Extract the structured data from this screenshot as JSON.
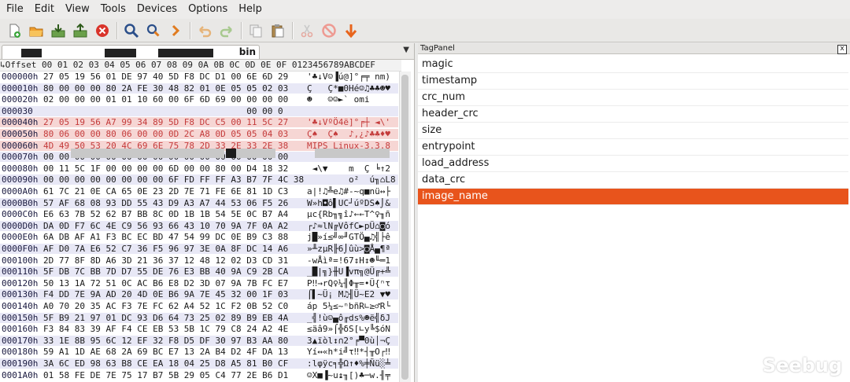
{
  "menu": [
    "File",
    "Edit",
    "View",
    "Tools",
    "Devices",
    "Options",
    "Help"
  ],
  "toolbar": {
    "buttons": [
      {
        "name": "new-file",
        "icon": "new-file-icon"
      },
      {
        "name": "open-file",
        "icon": "open-folder-icon"
      },
      {
        "name": "import",
        "icon": "import-icon"
      },
      {
        "name": "export",
        "icon": "export-icon"
      },
      {
        "name": "stop",
        "icon": "stop-icon"
      },
      {
        "name": "find",
        "icon": "magnifier-icon"
      },
      {
        "name": "find-replace",
        "icon": "find-replace-icon"
      },
      {
        "name": "go-next",
        "icon": "chevron-right-icon"
      },
      {
        "name": "undo",
        "icon": "undo-icon"
      },
      {
        "name": "redo",
        "icon": "redo-icon"
      },
      {
        "name": "copy",
        "icon": "copy-icon"
      },
      {
        "name": "paste",
        "icon": "paste-icon"
      },
      {
        "name": "cut",
        "icon": "scissors-icon"
      },
      {
        "name": "delete",
        "icon": "no-entry-icon"
      },
      {
        "name": "download",
        "icon": "arrow-down-icon"
      }
    ]
  },
  "hex_editor": {
    "tab_label": "bin",
    "header": "↳Offset 00 01 02 03 04 05 06 07 08 09 0A 0B 0C 0D 0E 0F 0123456789ABCDEF",
    "rows": [
      {
        "off": "000000h",
        "bytes": "27 05 19 56 01 DE 97 40 5D F8 DC D1 00 6E 6D 29",
        "ascii": "'♣↓V☺▐ú@]°╒╤ nm)"
      },
      {
        "off": "000010h",
        "bytes": "80 00 00 00 80 2A FE 30 48 82 01 0E 05 05 02 03",
        "ascii": "Ç   Ç*■0Hé☺♫♣♣☻♥"
      },
      {
        "off": "000020h",
        "bytes": "02 00 00 00 01 01 10 60 00 6F 6D 69 00 00 00 00",
        "ascii": "☻   ☺☺►` omi"
      },
      {
        "off": "000030",
        "bytes": "                                       00 00 0",
        "ascii": ""
      },
      {
        "off": "000040h",
        "bytes": "27 05 19 56 A7 99 34 89 5D F8 DC C5 00 11 5C 27",
        "ascii": "'♣↓VºÖ4ë]°╒┼ ◄\\'"
      },
      {
        "off": "000050h",
        "bytes": "80 06 00 00 80 06 00 00 0D 2C A8 0D 05 05 04 03",
        "ascii": "Ç♠  Ç♠  ♪,¿♪♣♣♦♥"
      },
      {
        "off": "000060h",
        "bytes": "4D 49 50 53 20 4C 69 6E 75 78 2D 33 2E 33 2E 38",
        "ascii": "MIPS Linux-3.3.8"
      },
      {
        "off": "000070h",
        "bytes": "00 00 00 00 00 00 00 00 00 00 00 00 00 00 00 00",
        "ascii": ""
      },
      {
        "off": "000080h",
        "bytes": "00 11 5C 1F 00 00 00 00 6D 00 00 80 00 D4 18 32",
        "ascii": " ◄\\▼    m  Ç ╘↑2"
      },
      {
        "off": "000090h",
        "bytes": "00 00 00 00 00 00 00 00 6F FD FF FF A3 B7 7F 4C 38",
        "ascii": "        o²  ú╖⌂L8"
      },
      {
        "off": "0000A0h",
        "bytes": "61 7C 21 0E CA 65 0E 23 2D 7E 71 FE 6E 81 1D C3",
        "ascii": "a|!♫╩e♫#-~q■nü↔├"
      },
      {
        "off": "0000B0h",
        "bytes": "57 AF 68 08 93 DD 55 43 D9 A3 A7 44 53 06 F5 26",
        "ascii": "W»h◘ô▌UC┘úºDS♠⌡&"
      },
      {
        "off": "0000C0h",
        "bytes": "E6 63 7B 52 62 B7 BB 8C 0D 1B 1B 54 5E 0C B7 A4",
        "ascii": "µc{Rb╖╗î♪←←T^♀╖ñ"
      },
      {
        "off": "0000D0h",
        "bytes": "DA 0D F7 6C 4E C9 56 93 66 43 10 70 9A 7F 0A A2",
        "ascii": "┌♪≈lN╔VôfC►pÜ⌂◙ó"
      },
      {
        "off": "0000E0h",
        "bytes": "6A DB AF A1 F3 BC EC BD 47 54 99 DC 0E B9 C3 88",
        "ascii": "j█»í≤╝∞╜GTÖ▄♫╣├ê"
      },
      {
        "off": "0000F0h",
        "bytes": "AF D0 7A E6 52 C7 36 F5 96 97 3E 0A 8F DC 14 A6",
        "ascii": "»╨zµR╟6⌡ûù>◙Å▄¶ª"
      },
      {
        "off": "000100h",
        "bytes": "2D 77 8F 8D A6 3D 21 36 37 12 48 12 02 D3 CD 31",
        "ascii": "-wÅìª=!67↕H↕☻╙═1"
      },
      {
        "off": "000110h",
        "bytes": "5F DB 7C BB 7D D7 55 DE 76 E3 BB 40 9A C9 2B CA",
        "ascii": "_█|╗}╫U▐vπ╗@Ü╔+╩"
      },
      {
        "off": "000120h",
        "bytes": "50 13 1A 72 51 0C AC B6 E8 D2 3D 07 9A 7B FC E7",
        "ascii": "P‼→rQ♀¼╢Φ╥=•Ü{ⁿτ"
      },
      {
        "off": "000130h",
        "bytes": "F4 DD 7E 9A AD 20 4D 0E B6 9A 7E 45 32 00 1F 03",
        "ascii": "⌠▌~Ü¡ M♫╢Ü~E2 ▼♥"
      },
      {
        "off": "000140h",
        "bytes": "A0 70 20 35 AC F3 7E FC 62 A4 52 1C F2 0B 52 C0",
        "ascii": "áp 5¼≤~ⁿbñR∟≥♂R└"
      },
      {
        "off": "000150h",
        "bytes": "5F B9 21 97 01 DC 93 D6 64 73 25 02 89 B9 EB 4A",
        "ascii": "_╣!ù☺▄ô╓ds%☻ë╣δJ"
      },
      {
        "off": "000160h",
        "bytes": "F3 84 83 39 AF F4 CE EB 53 5B 1C 79 C8 24 A2 4E",
        "ascii": "≤äâ9»⌠╬δS[∟y╚$óN"
      },
      {
        "off": "000170h",
        "bytes": "33 1E 8B 95 6C 12 EF 32 F8 D5 DF 30 97 B3 AA 80",
        "ascii": "3▲ïòl↕∩2°╒▀0ù│¬Ç"
      },
      {
        "off": "000180h",
        "bytes": "59 A1 1D AE 68 2A 69 BC E7 13 2A B4 D2 4F DA 13",
        "ascii": "Yí↔«h*i╝τ‼*┤╥O┌‼"
      },
      {
        "off": "000190h",
        "bytes": "3A 6C ED 98 63 B8 CE EA 18 04 25 D8 A5 81 B0 CF",
        "ascii": ":lφÿc╕╬Ω↑♦%╪Ñü░╧"
      },
      {
        "off": "0001A0h",
        "bytes": "01 58 FE DE 7E 75 17 B7 5B 29 05 C4 77 2E B6 D1",
        "ascii": "☺X■▐~u↨╖[)♣─w.╢╤"
      }
    ]
  },
  "tag_panel": {
    "title": "TagPanel",
    "close_label": "x",
    "items": [
      "magic",
      "timestamp",
      "crc_num",
      "header_crc",
      "size",
      "entrypoint",
      "load_address",
      "data_crc",
      "image_name"
    ],
    "selected": "image_name"
  },
  "watermark": {
    "text": "Seebug",
    "icon": "seebug-logo-icon"
  },
  "colors": {
    "selection": "#e8541c",
    "highlight_bg": "#f6d6d4",
    "highlight_text": "#c43b3b",
    "alt_row": "#e8e8f6"
  }
}
